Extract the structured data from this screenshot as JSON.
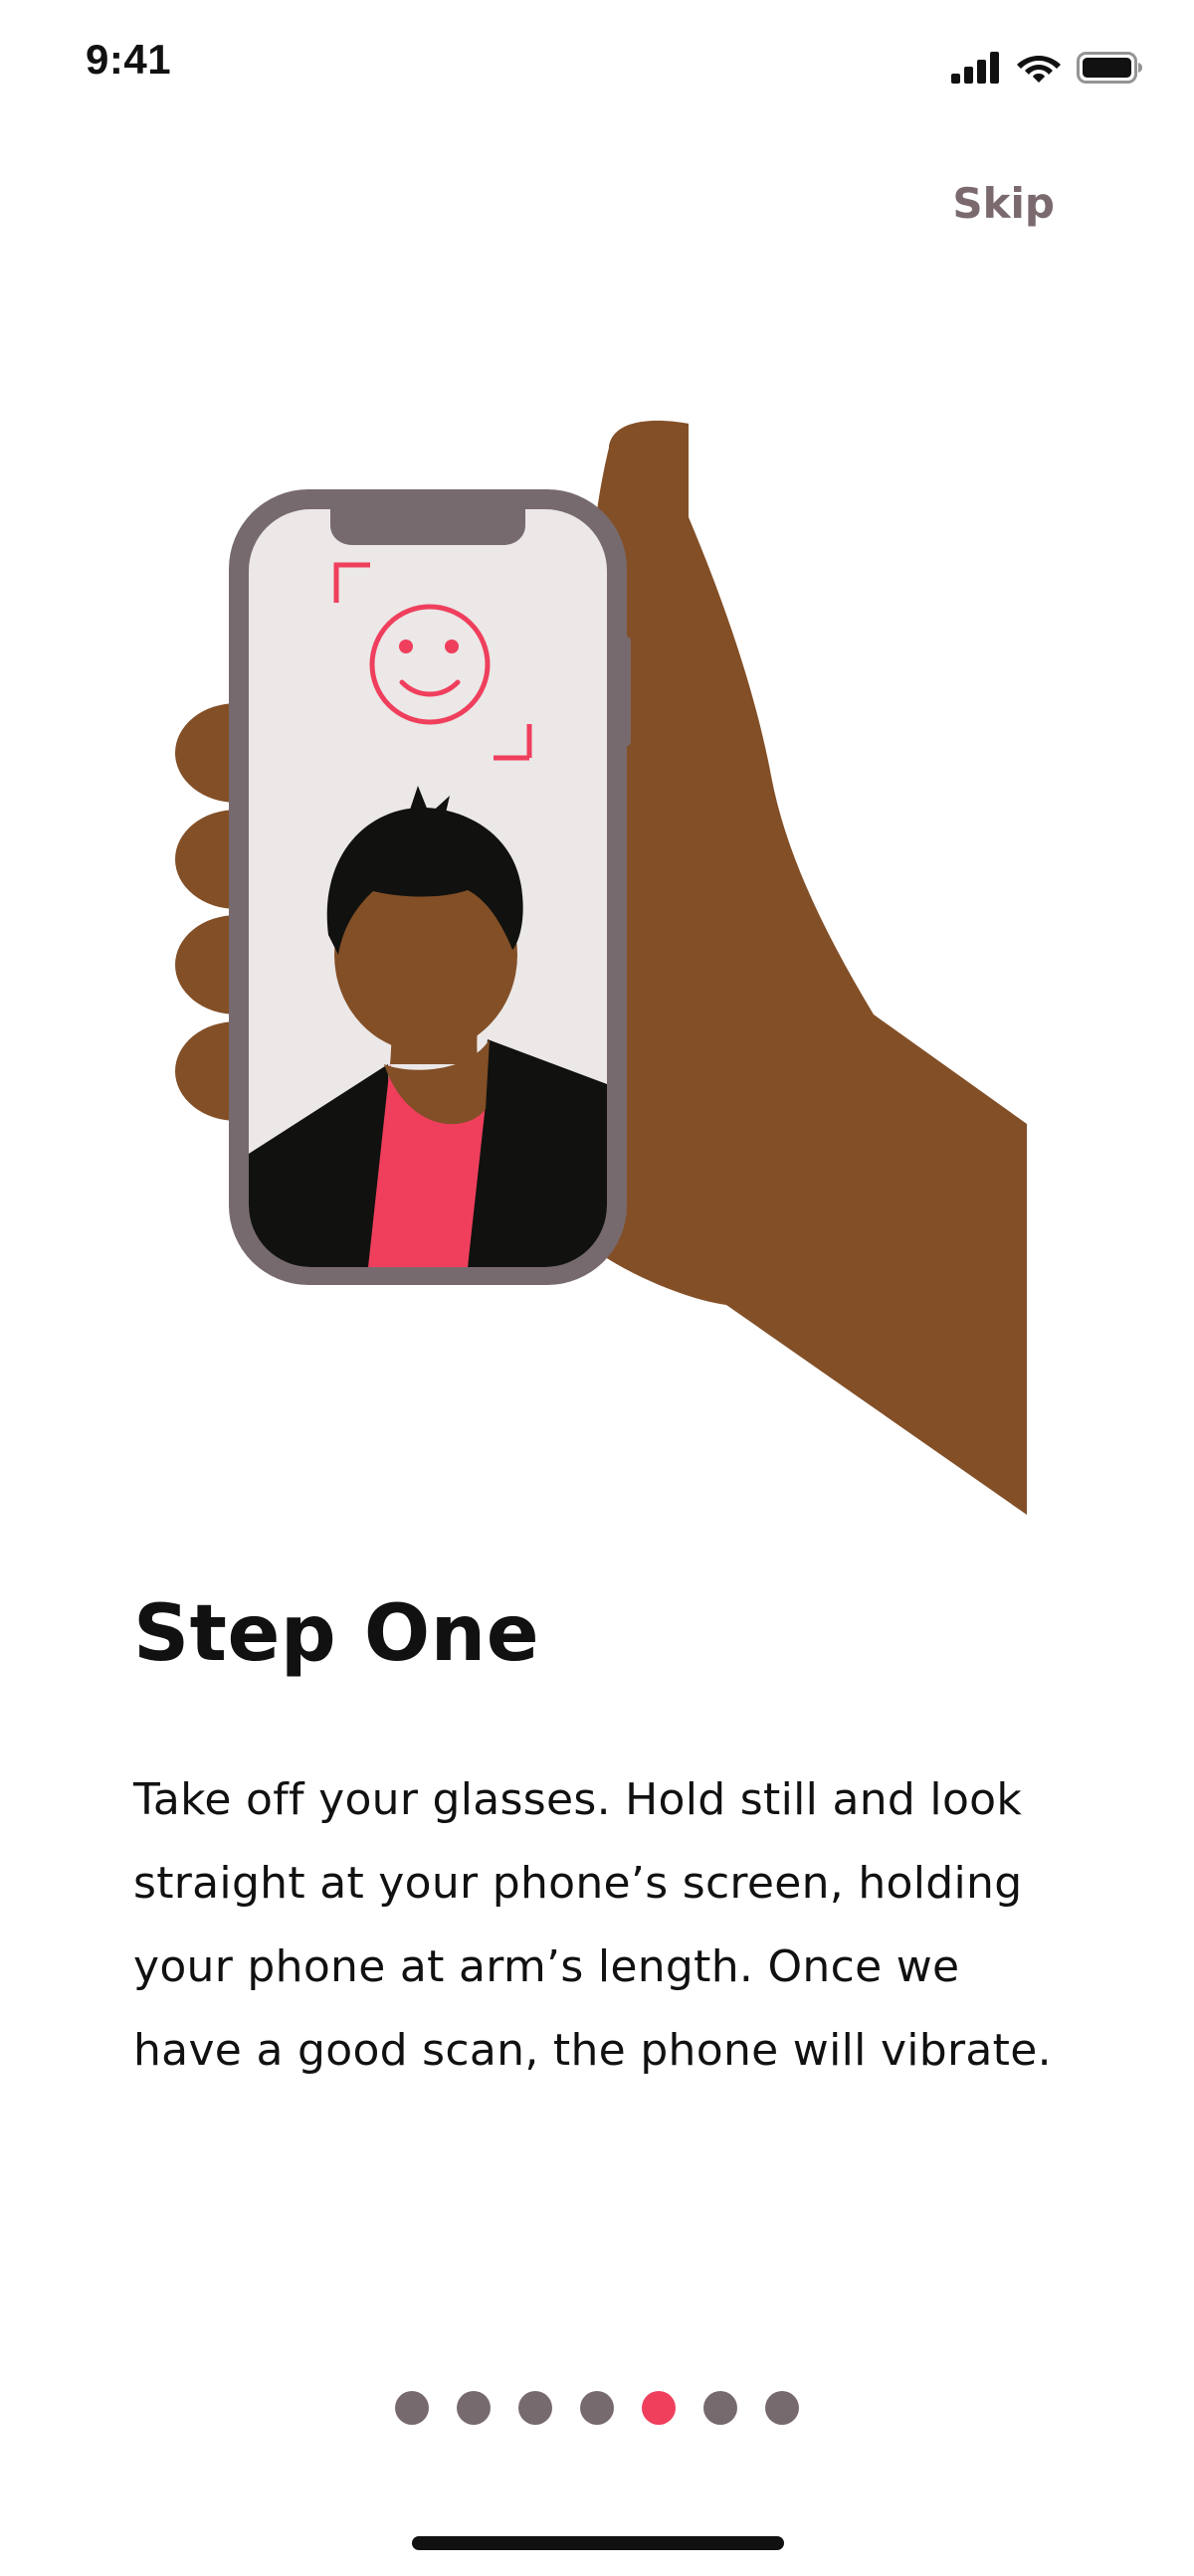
{
  "status_bar": {
    "time": "9:41",
    "icons": [
      "signal-icon",
      "wifi-icon",
      "battery-icon"
    ]
  },
  "header": {
    "skip_label": "Skip"
  },
  "illustration": {
    "icon": "hand-holding-phone-face-scan-illustration",
    "colors": {
      "skin": "#834f27",
      "phone_frame": "#776a6e",
      "screen": "#ebe8e7",
      "accent": "#ef3f5d",
      "hair_jacket": "#11120f"
    }
  },
  "content": {
    "title": "Step One",
    "body": "Take off your glasses. Hold still and look straight at your phone’s screen, holding your phone at arm’s length. Once we have a good scan, the phone will vibrate."
  },
  "pager": {
    "total": 7,
    "active_index": 4,
    "colors": {
      "inactive": "#776a6e",
      "active": "#ef3f5d"
    }
  }
}
